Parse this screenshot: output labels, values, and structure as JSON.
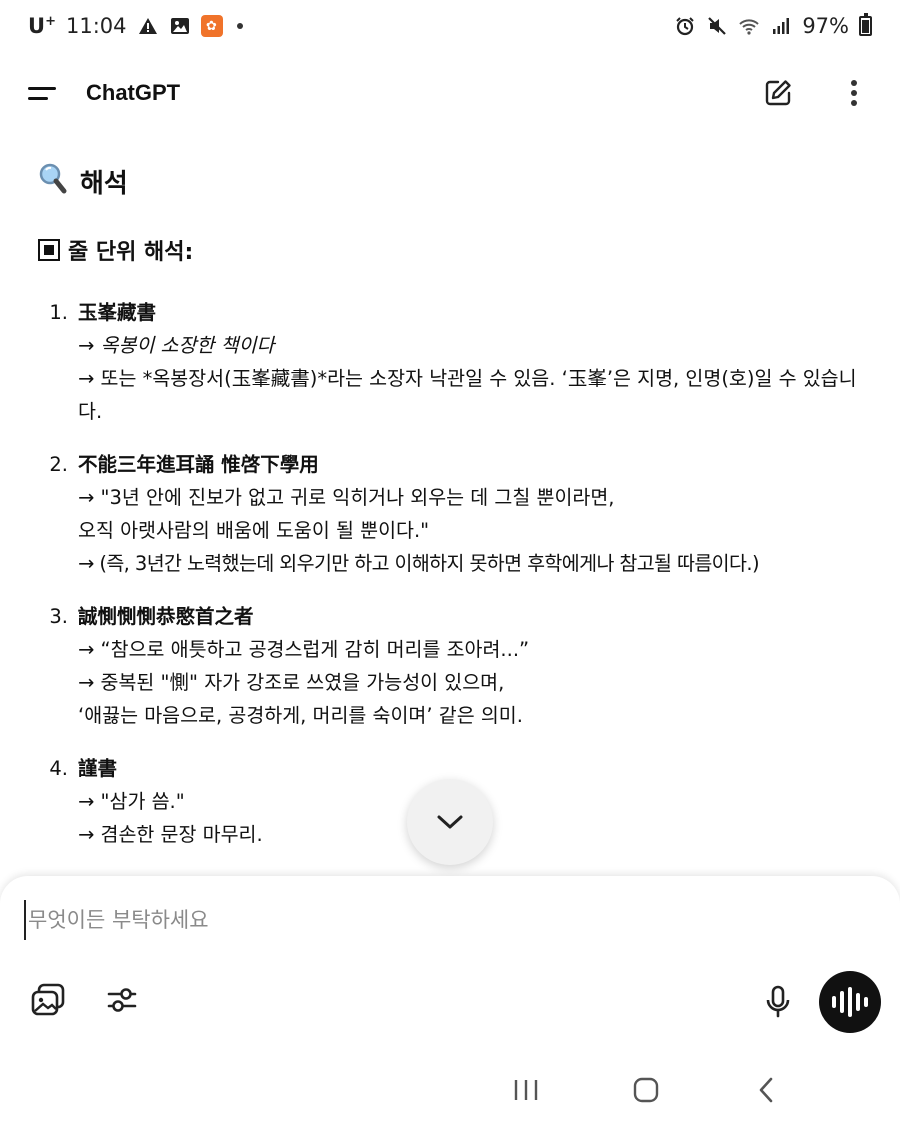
{
  "status_bar": {
    "carrier": "U",
    "carrier_sup": "+",
    "time": "11:04",
    "battery": "97%"
  },
  "header": {
    "title": "ChatGPT"
  },
  "content": {
    "section_title": "해석",
    "subsection_title": "줄 단위 해석:",
    "items": [
      {
        "num": "1.",
        "head": "玉峯藏書",
        "lines": [
          "→ 옥봉이 소장한 책이다",
          "→ 또는 *옥봉장서(玉峯藏書)*라는 소장자 낙관일 수 있음. ‘玉峯’은 지명, 인명(호)일 수 있습니다."
        ]
      },
      {
        "num": "2.",
        "head": "不能三年進耳誦 惟啓下學用",
        "lines": [
          "→ \"3년 안에 진보가 없고 귀로 익히거나 외우는 데 그칠 뿐이라면,",
          "오직 아랫사람의 배움에 도움이 될 뿐이다.\"",
          "→ (즉, 3년간 노력했는데 외우기만 하고 이해하지 못하면 후학에게나 참고될 따름이다.)"
        ]
      },
      {
        "num": "3.",
        "head": "誠惻惻惻恭愍首之者",
        "lines": [
          "→ “참으로 애틋하고 공경스럽게 감히 머리를 조아려...”",
          "→ 중복된 \"惻\" 자가 강조로 쓰였을 가능성이 있으며,",
          "‘애끓는 마음으로, 공경하게, 머리를 숙이며’ 같은 의미."
        ]
      },
      {
        "num": "4.",
        "head": "謹書",
        "lines": [
          "→ \"삼가 씀.\"",
          "→ 겸손한 문장 마무리."
        ]
      }
    ]
  },
  "composer": {
    "placeholder": "무엇이든 부탁하세요",
    "value": ""
  }
}
